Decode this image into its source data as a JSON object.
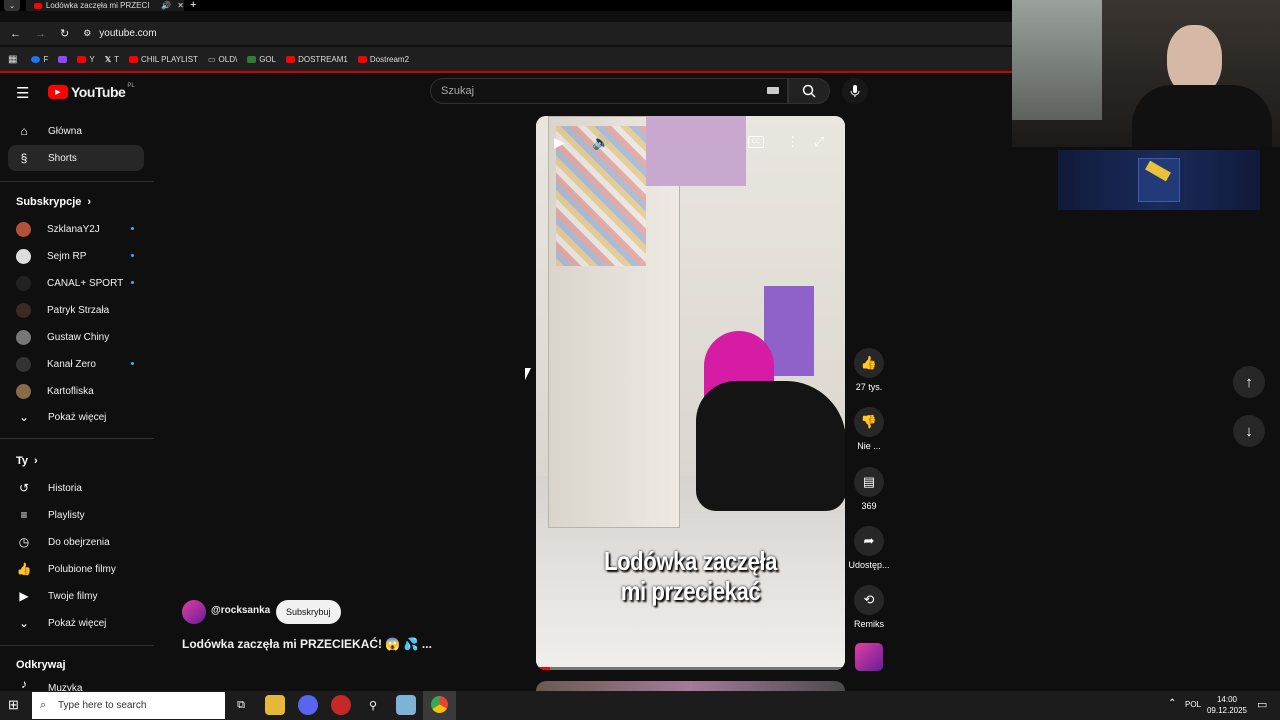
{
  "browser": {
    "tab_title": "Lodówka zaczęła mi PRZECI",
    "address": "youtube.com",
    "bookmarks": [
      {
        "label": "F",
        "color": "#1877f2"
      },
      {
        "label": "",
        "color": "#9146ff"
      },
      {
        "label": "Y",
        "color": "#ff0000"
      },
      {
        "label": "T",
        "color": "#ffffff"
      },
      {
        "label": "CHIL PLAYLIST",
        "color": "#ff0000"
      },
      {
        "label": "OLD\\",
        "color": "#888888"
      },
      {
        "label": "GOL",
        "color": "#2e7d32"
      },
      {
        "label": "DOSTREAM1",
        "color": "#ff0000"
      },
      {
        "label": "Dostream2",
        "color": "#ff0000"
      }
    ]
  },
  "header": {
    "logo_text": "YouTube",
    "region": "PL",
    "search_placeholder": "Szukaj"
  },
  "sidebar": {
    "main": [
      {
        "label": "Główna",
        "icon": "home-icon"
      },
      {
        "label": "Shorts",
        "icon": "shorts-icon"
      }
    ],
    "subscriptions_title": "Subskrypcje",
    "subscriptions": [
      {
        "label": "SzklanaY2J",
        "color": "#b5503a",
        "new": true
      },
      {
        "label": "Sejm RP",
        "color": "#dddddd",
        "new": true
      },
      {
        "label": "CANAL+ SPORT",
        "color": "#222222",
        "new": true
      },
      {
        "label": "Patryk Strzała",
        "color": "#3a2a20",
        "new": false
      },
      {
        "label": "Gustaw Chiny",
        "color": "#777777",
        "new": false
      },
      {
        "label": "Kanał Zero",
        "color": "#333333",
        "new": true
      },
      {
        "label": "Kartofliska",
        "color": "#8a6a4a",
        "new": false
      }
    ],
    "show_more_1": "Pokaż więcej",
    "you_title": "Ty",
    "you_items": [
      {
        "label": "Historia",
        "icon": "history-icon"
      },
      {
        "label": "Playlisty",
        "icon": "playlist-icon"
      },
      {
        "label": "Do obejrzenia",
        "icon": "clock-icon"
      },
      {
        "label": "Polubione filmy",
        "icon": "thumb-up-icon"
      },
      {
        "label": "Twoje filmy",
        "icon": "video-icon"
      }
    ],
    "show_more_2": "Pokaż więcej",
    "explore_title": "Odkrywaj",
    "explore_items": [
      {
        "label": "Muzyka",
        "icon": "music-icon"
      }
    ]
  },
  "short": {
    "channel": "@rocksanka",
    "subscribe_label": "Subskrybuj",
    "title": "Lodówka zaczęła mi PRZECIEKAĆ! 😱 💦 ...",
    "caption_line1": "Lodówka zaczęła",
    "caption_line2": "mi przeciekać",
    "actions": {
      "likes": "27 tys.",
      "dislike": "Nie ...",
      "comments": "369",
      "share": "Udostęp...",
      "remix": "Remiks"
    }
  },
  "taskbar": {
    "search_placeholder": "Type here to search",
    "language": "POL",
    "time": "14:00",
    "date": "09.12.2025"
  }
}
